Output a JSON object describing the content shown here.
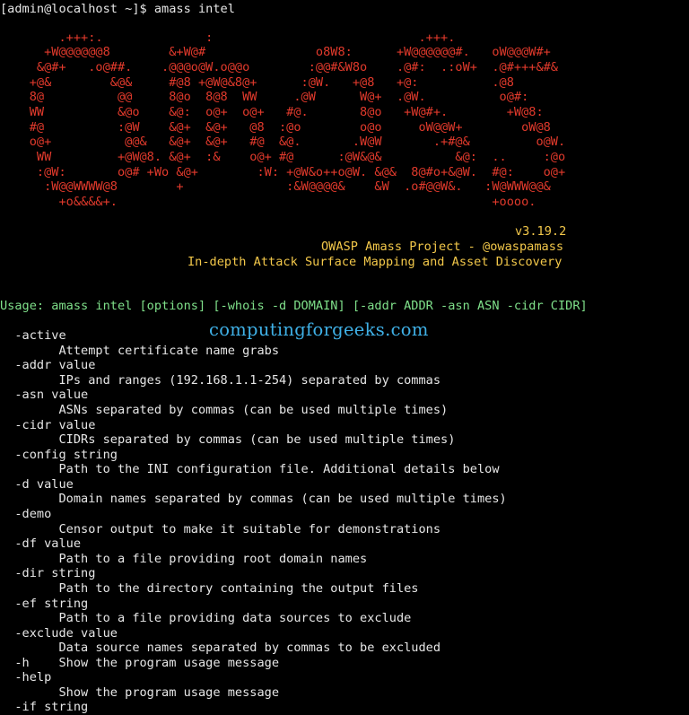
{
  "prompt": "[admin@localhost ~]$ amass intel",
  "banner_art": [
    "        .+++:.              :                            .+++.",
    "      +W@@@@@@8        &+W@#               o8W8:      +W@@@@@@#.   oW@@@W#+",
    "     &@#+   .o@##.    .@@@o@W.o@@o        :@@#&W8o    .@#:  .:oW+  .@#+++&#&",
    "    +@&        &@&     #@8 +@W@&8@+      :@W.   +@8   +@:          .@8",
    "    8@          @@     8@o  8@8  WW     .@W      W@+  .@W.          o@#:",
    "    WW          &@o    &@:  o@+  o@+   #@.       8@o   +W@#+.        +W@8:",
    "    #@          :@W    &@+  &@+   @8  :@o        o@o     oW@@W+        oW@8",
    "    o@+          @@&   &@+  &@+   #@  &@.       .W@W       .+#@&         o@W.",
    "     WW         +@W@8. &@+  :&    o@+ #@      :@W&@&          &@:  ..     :@o",
    "     :@W:       o@# +Wo &@+        :W: +@W&o++o@W. &@&  8@#o+&@W.  #@:    o@+",
    "      :W@@WWWW@8        +              :&W@@@@&    &W  .o#@@W&.   :W@WWW@@&",
    "        +o&&&&+.                                                   +oooo."
  ],
  "version": "v3.19.2",
  "project": "OWASP Amass Project - @owaspamass",
  "tagline": "In-depth Attack Surface Mapping and Asset Discovery",
  "usage": "Usage: amass intel [options] [-whois -d DOMAIN] [-addr ADDR -asn ASN -cidr CIDR]",
  "watermark": "computingforgeeks.com",
  "help_lines": [
    "  -active",
    "        Attempt certificate name grabs",
    "  -addr value",
    "        IPs and ranges (192.168.1.1-254) separated by commas",
    "  -asn value",
    "        ASNs separated by commas (can be used multiple times)",
    "  -cidr value",
    "        CIDRs separated by commas (can be used multiple times)",
    "  -config string",
    "        Path to the INI configuration file. Additional details below",
    "  -d value",
    "        Domain names separated by commas (can be used multiple times)",
    "  -demo",
    "        Censor output to make it suitable for demonstrations",
    "  -df value",
    "        Path to a file providing root domain names",
    "  -dir string",
    "        Path to the directory containing the output files",
    "  -ef string",
    "        Path to a file providing data sources to exclude",
    "  -exclude value",
    "        Data source names separated by commas to be excluded",
    "  -h    Show the program usage message",
    "  -help",
    "        Show the program usage message",
    "  -if string"
  ]
}
